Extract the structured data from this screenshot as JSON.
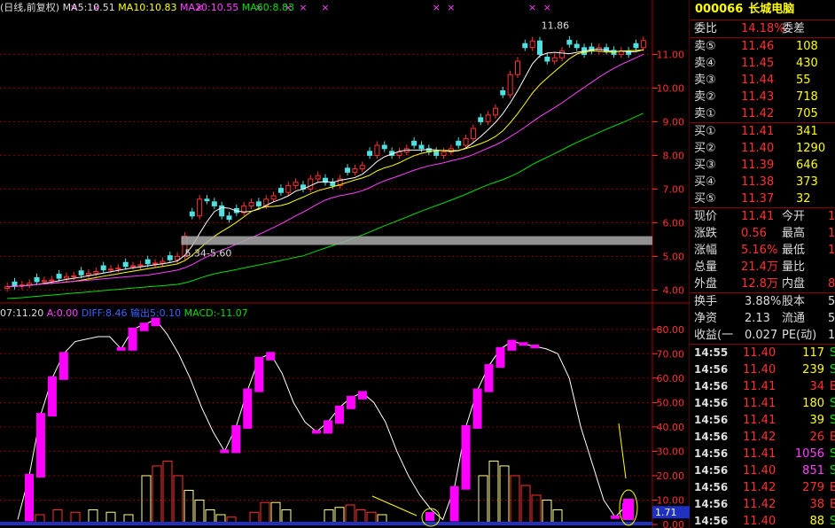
{
  "stock": {
    "code": "000066",
    "name": "长城电脑"
  },
  "top_legend": {
    "ma5": "MA5:10.51",
    "ma10": "MA10:10.83",
    "ma20": "MA20:10.55",
    "ma60": "MA60:8.83"
  },
  "lower_legend": {
    "date": "07:11.20",
    "a": "A:0.00",
    "diff": "DIFF:8.46",
    "out": "输出5:0.10",
    "macd": "MACD:-11.07"
  },
  "annotations": {
    "high_label": "11.86",
    "range_label": "5.34-5.60",
    "current_tag": "1.71"
  },
  "price_axis": [
    "11.00",
    "10.00",
    "9.00",
    "8.00",
    "7.00",
    "6.00",
    "5.00",
    "4.00"
  ],
  "indicator_axis": [
    "80.00",
    "70.00",
    "60.00",
    "50.00",
    "40.00",
    "30.00",
    "20.00",
    "10.00",
    "0.00"
  ],
  "quote": {
    "weibi_label": "委比",
    "weibi": "14.18%",
    "weicha_label": "委差",
    "weicha": "",
    "asks": [
      {
        "label": "卖⑤",
        "price": "11.46",
        "vol": "108"
      },
      {
        "label": "卖④",
        "price": "11.45",
        "vol": "430"
      },
      {
        "label": "卖③",
        "price": "11.44",
        "vol": "55"
      },
      {
        "label": "卖②",
        "price": "11.43",
        "vol": "718"
      },
      {
        "label": "卖①",
        "price": "11.42",
        "vol": "705"
      }
    ],
    "bids": [
      {
        "label": "买①",
        "price": "11.41",
        "vol": "341"
      },
      {
        "label": "买②",
        "price": "11.40",
        "vol": "1290"
      },
      {
        "label": "买③",
        "price": "11.39",
        "vol": "646"
      },
      {
        "label": "买④",
        "price": "11.38",
        "vol": "373"
      },
      {
        "label": "买⑤",
        "price": "11.37",
        "vol": "32"
      }
    ],
    "stats1": [
      {
        "l1": "现价",
        "v1": "11.41",
        "l2": "今开",
        "v2": "1"
      },
      {
        "l1": "涨跌",
        "v1": "0.56",
        "l2": "最高",
        "v2": "1"
      },
      {
        "l1": "涨幅",
        "v1": "5.16%",
        "l2": "最低",
        "v2": "1"
      },
      {
        "l1": "总量",
        "v1": "21.4万",
        "l2": "量比",
        "v2": ""
      },
      {
        "l1": "外盘",
        "v1": "12.8万",
        "l2": "内盘",
        "v2": "8"
      }
    ],
    "stats2": [
      {
        "l1": "换手",
        "v1": "3.88%",
        "l2": "股本",
        "v2": "5"
      },
      {
        "l1": "净资",
        "v1": "2.13",
        "l2": "流通",
        "v2": "5."
      },
      {
        "l1": "收益(一",
        "v1": "0.027",
        "l2": "PE(动)",
        "v2": "1"
      }
    ],
    "ticks": [
      {
        "time": "14:55",
        "price": "11.40",
        "vol": "117",
        "flag": "S"
      },
      {
        "time": "14:56",
        "price": "11.40",
        "vol": "239",
        "flag": "S"
      },
      {
        "time": "14:56",
        "price": "11.41",
        "vol": "34",
        "flag": "B"
      },
      {
        "time": "14:56",
        "price": "11.41",
        "vol": "180",
        "flag": "S"
      },
      {
        "time": "14:56",
        "price": "11.41",
        "vol": "39",
        "flag": "S"
      },
      {
        "time": "14:56",
        "price": "11.42",
        "vol": "26",
        "flag": "B"
      },
      {
        "time": "14:56",
        "price": "11.41",
        "vol": "1056",
        "flag": "S"
      },
      {
        "time": "14:56",
        "price": "11.40",
        "vol": "851",
        "flag": "S"
      },
      {
        "time": "14:56",
        "price": "11.42",
        "vol": "279",
        "flag": "B"
      },
      {
        "time": "14:56",
        "price": "11.42",
        "vol": "38",
        "flag": "B"
      },
      {
        "time": "14:56",
        "price": "11.40",
        "vol": "88",
        "flag": "S"
      }
    ]
  },
  "colors": {
    "up": "#ff3030",
    "down": "#50e0e0",
    "ma5": "#ffffff",
    "ma10": "#ffff00",
    "ma20": "#ff40ff",
    "ma60": "#00e000",
    "indicator": "#ff00ff",
    "grid": "#800000"
  },
  "chart_data": {
    "type": "candlestick",
    "ylim": [
      3.8,
      12.3
    ],
    "closes": [
      4.1,
      4.12,
      4.15,
      4.2,
      4.25,
      4.28,
      4.3,
      4.35,
      4.4,
      4.42,
      4.45,
      4.5,
      4.55,
      4.6,
      4.62,
      4.65,
      4.7,
      4.72,
      4.75,
      4.78,
      4.8,
      4.85,
      4.9,
      5.0,
      5.6,
      6.2,
      6.7,
      6.65,
      6.5,
      6.2,
      6.1,
      6.3,
      6.5,
      6.6,
      6.5,
      6.7,
      6.8,
      6.9,
      7.1,
      7.2,
      7.0,
      7.3,
      7.4,
      7.2,
      7.1,
      7.3,
      7.5,
      7.6,
      7.7,
      8.0,
      8.3,
      8.2,
      8.0,
      8.1,
      8.2,
      8.3,
      8.2,
      8.1,
      8.0,
      8.1,
      8.2,
      8.3,
      8.5,
      8.8,
      9.0,
      9.2,
      9.4,
      9.8,
      10.4,
      10.8,
      11.2,
      11.4,
      11.0,
      10.8,
      10.9,
      11.1,
      11.3,
      11.2,
      11.0,
      11.1,
      11.2,
      11.1,
      11.0,
      11.1,
      11.0,
      11.2,
      11.41
    ],
    "indicator_ylim": [
      0,
      85
    ]
  }
}
